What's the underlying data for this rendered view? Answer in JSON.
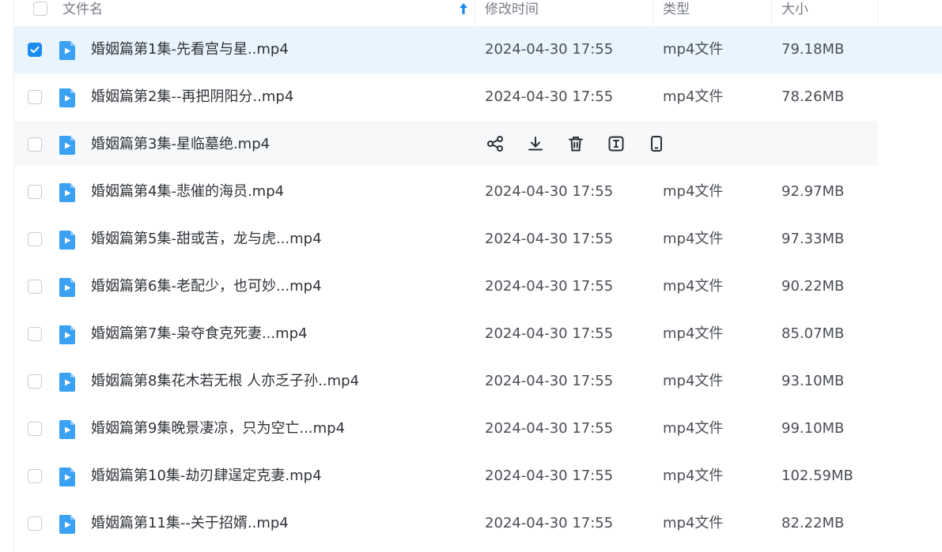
{
  "header": {
    "name": "文件名",
    "modified": "修改时间",
    "type": "类型",
    "size": "大小",
    "sort_icon": "sort-ascending-arrow-icon"
  },
  "accent_color": "#1a8cf0",
  "row_actions": [
    "share-icon",
    "download-icon",
    "delete-icon",
    "rename-icon",
    "phone-icon"
  ],
  "files": [
    {
      "name": "婚姻篇第1集-先看宫与星..mp4",
      "date": "2024-04-30 17:55",
      "type": "mp4文件",
      "size": "79.18MB",
      "checked": true
    },
    {
      "name": "婚姻篇第2集--再把阴阳分..mp4",
      "date": "2024-04-30 17:55",
      "type": "mp4文件",
      "size": "78.26MB",
      "checked": false
    },
    {
      "name": "婚姻篇第3集-星临墓绝.mp4",
      "date": "",
      "type": "",
      "size": "",
      "checked": false,
      "hovered": true
    },
    {
      "name": "婚姻篇第4集-悲催的海员.mp4",
      "date": "2024-04-30 17:55",
      "type": "mp4文件",
      "size": "92.97MB",
      "checked": false
    },
    {
      "name": "婚姻篇第5集-甜或苦，龙与虎...mp4",
      "date": "2024-04-30 17:55",
      "type": "mp4文件",
      "size": "97.33MB",
      "checked": false
    },
    {
      "name": "婚姻篇第6集-老配少，也可妙...mp4",
      "date": "2024-04-30 17:55",
      "type": "mp4文件",
      "size": "90.22MB",
      "checked": false
    },
    {
      "name": "婚姻篇第7集-枭夺食克死妻...mp4",
      "date": "2024-04-30 17:55",
      "type": "mp4文件",
      "size": "85.07MB",
      "checked": false
    },
    {
      "name": "婚姻篇第8集花木若无根 人亦乏子孙..mp4",
      "date": "2024-04-30 17:55",
      "type": "mp4文件",
      "size": "93.10MB",
      "checked": false
    },
    {
      "name": "婚姻篇第9集晚景凄凉，只为空亡...mp4",
      "date": "2024-04-30 17:55",
      "type": "mp4文件",
      "size": "99.10MB",
      "checked": false
    },
    {
      "name": "婚姻篇第10集-劫刃肆逞定克妻.mp4",
      "date": "2024-04-30 17:55",
      "type": "mp4文件",
      "size": "102.59MB",
      "checked": false
    },
    {
      "name": "婚姻篇第11集--关于招婿..mp4",
      "date": "2024-04-30 17:55",
      "type": "mp4文件",
      "size": "82.22MB",
      "checked": false
    }
  ]
}
